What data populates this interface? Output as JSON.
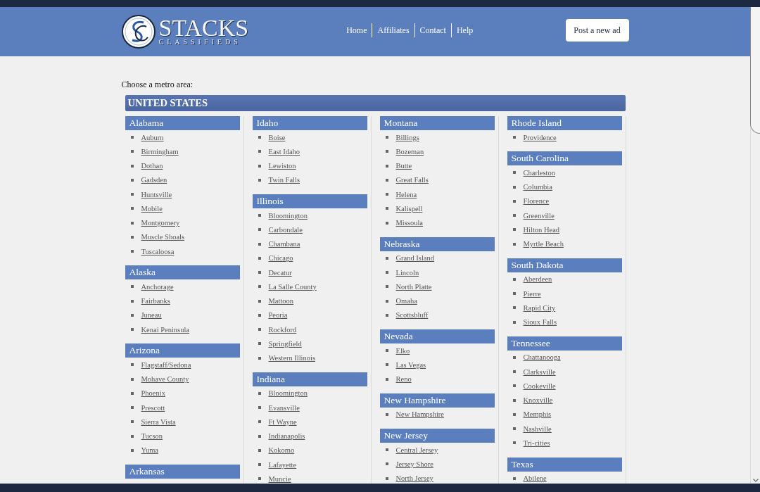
{
  "header": {
    "logo": {
      "title": "STACKS",
      "subtitle": "CLASSIFIEDS"
    },
    "nav": [
      "Home",
      "Affiliates",
      "Contact",
      "Help"
    ],
    "post_button": "Post a new ad"
  },
  "prompt": "Choose a metro area:",
  "country": {
    "name": "UNITED STATES",
    "columns": [
      {
        "states": [
          {
            "name": "Alabama",
            "cities": [
              "Auburn",
              "Birmingham",
              "Dothan",
              "Gadsden",
              "Huntsville",
              "Mobile",
              "Montgomery",
              "Muscle Shoals",
              "Tuscaloosa"
            ]
          },
          {
            "name": "Alaska",
            "cities": [
              "Anchorage",
              "Fairbanks",
              "Juneau",
              "Kenai Peninsula"
            ]
          },
          {
            "name": "Arizona",
            "cities": [
              "Flagstaff/Sedona",
              "Mohave County",
              "Phoenix",
              "Prescott",
              "Sierra Vista",
              "Tucson",
              "Yuma"
            ]
          },
          {
            "name": "Arkansas"
          }
        ]
      },
      {
        "states": [
          {
            "name": "Idaho",
            "cities": [
              "Boise",
              "East Idaho",
              "Lewiston",
              "Twin Falls"
            ]
          },
          {
            "name": "Illinois",
            "cities": [
              "Bloomington",
              "Carbondale",
              "Chambana",
              "Chicago",
              "Decatur",
              "La Salle County",
              "Mattoon",
              "Peoria",
              "Rockford",
              "Springfield",
              "Western Illinois"
            ]
          },
          {
            "name": "Indiana",
            "cities": [
              "Bloomington",
              "Evansville",
              "Ft Wayne",
              "Indianapolis",
              "Kokomo",
              "Lafayette",
              "Muncie"
            ]
          }
        ]
      },
      {
        "states": [
          {
            "name": "Montana",
            "cities": [
              "Billings",
              "Bozeman",
              "Butte",
              "Great Falls",
              "Helena",
              "Kalispell",
              "Missoula"
            ]
          },
          {
            "name": "Nebraska",
            "cities": [
              "Grand Island",
              "Lincoln",
              "North Platte",
              "Omaha",
              "Scottsbluff"
            ]
          },
          {
            "name": "Nevada",
            "cities": [
              "Elko",
              "Las Vegas",
              "Reno"
            ]
          },
          {
            "name": "New Hampshire",
            "cities": [
              "New Hampshire"
            ]
          },
          {
            "name": "New Jersey",
            "cities": [
              "Central Jersey",
              "Jersey Shore",
              "North Jersey"
            ]
          }
        ]
      },
      {
        "states": [
          {
            "name": "Rhode Island",
            "cities": [
              "Providence"
            ]
          },
          {
            "name": "South Carolina",
            "cities": [
              "Charleston",
              "Columbia",
              "Florence",
              "Greenville",
              "Hilton Head",
              "Myrtle Beach"
            ]
          },
          {
            "name": "South Dakota",
            "cities": [
              "Aberdeen",
              "Pierre",
              "Rapid City",
              "Sioux Falls"
            ]
          },
          {
            "name": "Tennessee",
            "cities": [
              "Chattanooga",
              "Clarksville",
              "Cookeville",
              "Knoxville",
              "Memphis",
              "Nashville",
              "Tri-cities"
            ]
          },
          {
            "name": "Texas",
            "cities": [
              "Abilene"
            ]
          }
        ]
      }
    ]
  }
}
